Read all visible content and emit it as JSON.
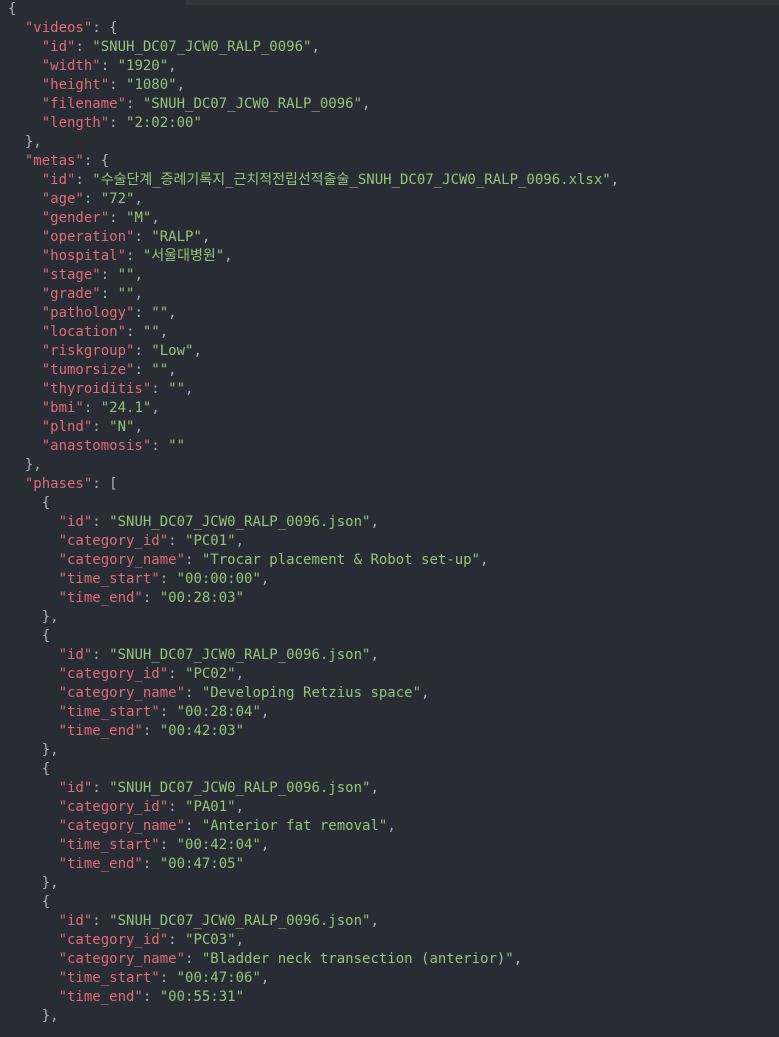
{
  "code": {
    "videos": {
      "id": "SNUH_DC07_JCW0_RALP_0096",
      "width": "1920",
      "height": "1080",
      "filename": "SNUH_DC07_JCW0_RALP_0096",
      "length": "2:02:00"
    },
    "metas": {
      "id": "수술단계_증례기록지_근치적전립선적출술_SNUH_DC07_JCW0_RALP_0096.xlsx",
      "age": "72",
      "gender": "M",
      "operation": "RALP",
      "hospital": "서울대병원",
      "stage": "",
      "grade": "",
      "pathology": "",
      "location": "",
      "riskgroup": "Low",
      "tumorsize": "",
      "thyroiditis": "",
      "bmi": "24.1",
      "plnd": "N",
      "anastomosis": ""
    },
    "phases": [
      {
        "id": "SNUH_DC07_JCW0_RALP_0096.json",
        "category_id": "PC01",
        "category_name": "Trocar placement & Robot set-up",
        "time_start": "00:00:00",
        "time_end": "00:28:03"
      },
      {
        "id": "SNUH_DC07_JCW0_RALP_0096.json",
        "category_id": "PC02",
        "category_name": "Developing Retzius space",
        "time_start": "00:28:04",
        "time_end": "00:42:03"
      },
      {
        "id": "SNUH_DC07_JCW0_RALP_0096.json",
        "category_id": "PA01",
        "category_name": "Anterior fat removal",
        "time_start": "00:42:04",
        "time_end": "00:47:05"
      },
      {
        "id": "SNUH_DC07_JCW0_RALP_0096.json",
        "category_id": "PC03",
        "category_name": "Bladder neck transection (anterior)",
        "time_start": "00:47:06",
        "time_end": "00:55:31"
      }
    ]
  }
}
